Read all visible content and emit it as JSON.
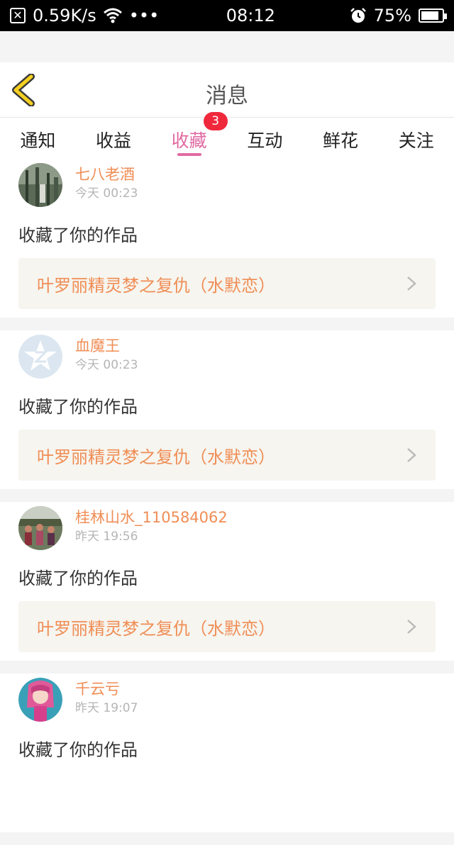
{
  "status_bar": {
    "network_speed": "0.59K/s",
    "more": "•••",
    "time": "08:12",
    "battery": "75%"
  },
  "header": {
    "title": "消息"
  },
  "tabs": [
    {
      "label": "通知"
    },
    {
      "label": "收益"
    },
    {
      "label": "收藏",
      "badge": "3",
      "active": true
    },
    {
      "label": "互动"
    },
    {
      "label": "鲜花"
    },
    {
      "label": "关注"
    }
  ],
  "messages": [
    {
      "user": "七八老酒",
      "time": "今天 00:23",
      "action": "收藏了你的作品",
      "work": "叶罗丽精灵梦之复仇（水默恋）"
    },
    {
      "user": "血魔王",
      "time": "今天 00:23",
      "action": "收藏了你的作品",
      "work": "叶罗丽精灵梦之复仇（水默恋）"
    },
    {
      "user": "桂林山水_110584062",
      "time": "昨天 19:56",
      "action": "收藏了你的作品",
      "work": "叶罗丽精灵梦之复仇（水默恋）"
    },
    {
      "user": "千云亏",
      "time": "昨天 19:07",
      "action": "收藏了你的作品",
      "work": ""
    }
  ],
  "colors": {
    "accent": "#e06aa2",
    "username": "#f08d55",
    "badge": "#f0283c",
    "back_arrow": "#f5d020"
  }
}
